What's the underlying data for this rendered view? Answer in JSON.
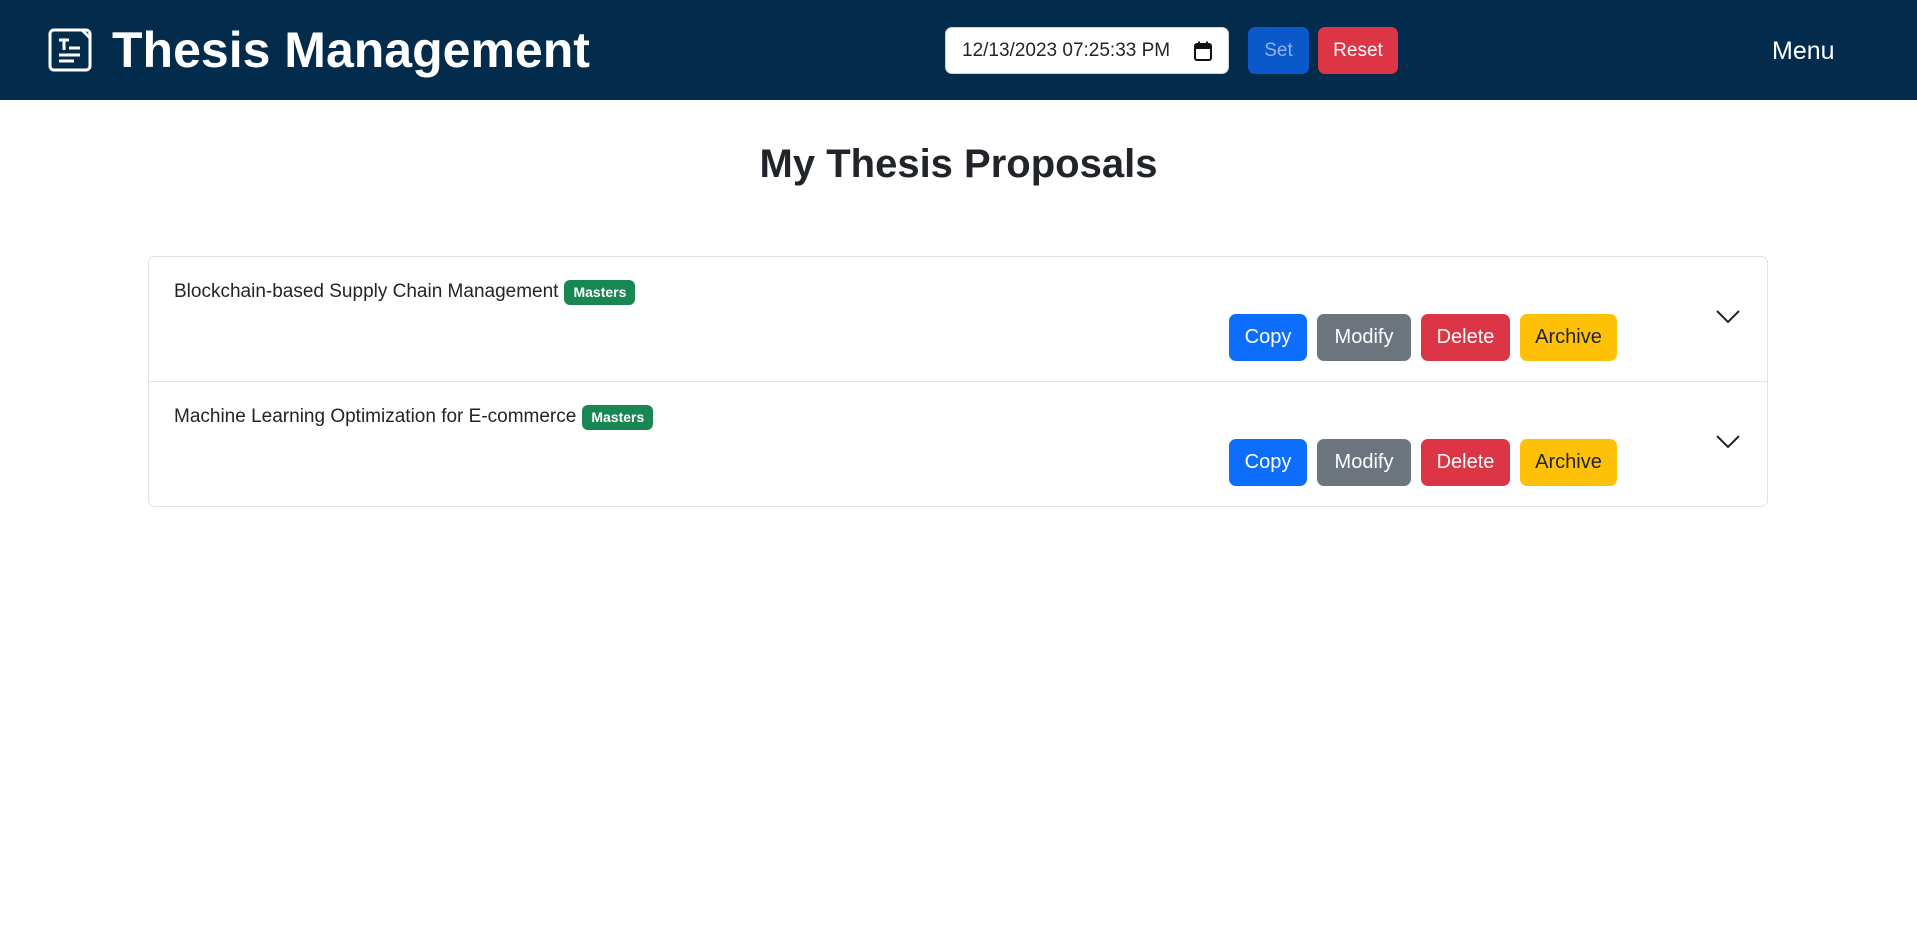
{
  "navbar": {
    "brand_title": "Thesis Management",
    "brand_icon": "document-text-icon",
    "date_value": "12/13/2023 07:25:33  PM",
    "calendar_icon": "calendar-icon",
    "set_label": "Set",
    "reset_label": "Reset",
    "menu_label": "Menu"
  },
  "main": {
    "page_title": "My Thesis Proposals",
    "proposals": [
      {
        "title": "Blockchain-based Supply Chain Management",
        "badge": "Masters",
        "copy_label": "Copy",
        "modify_label": "Modify",
        "delete_label": "Delete",
        "archive_label": "Archive",
        "expand_icon": "chevron-down-icon"
      },
      {
        "title": "Machine Learning Optimization for E-commerce",
        "badge": "Masters",
        "copy_label": "Copy",
        "modify_label": "Modify",
        "delete_label": "Delete",
        "archive_label": "Archive",
        "expand_icon": "chevron-down-icon"
      }
    ]
  },
  "colors": {
    "navbar_bg": "#022b4c",
    "primary": "#0d6efd",
    "secondary": "#6c757d",
    "danger": "#dc3545",
    "warning": "#ffc107",
    "success_badge": "#198754"
  }
}
